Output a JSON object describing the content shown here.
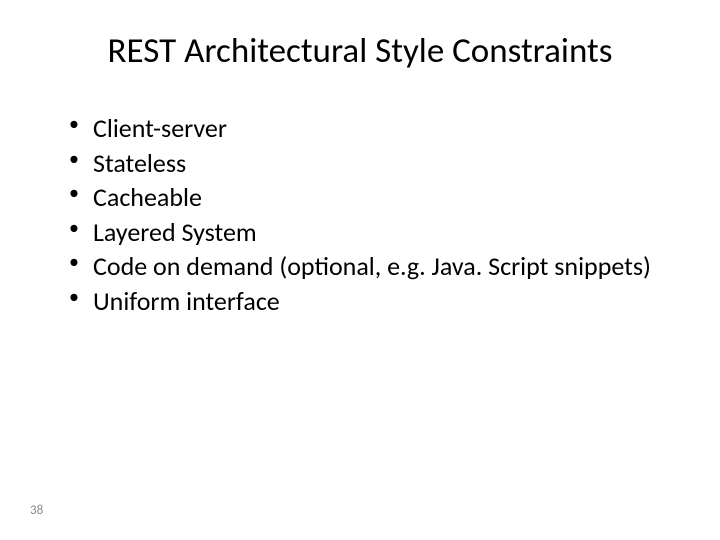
{
  "title": "REST Architectural Style Constraints",
  "bullets": [
    "Client-server",
    "Stateless",
    "Cacheable",
    "Layered System",
    "Code on demand (optional, e.g. Java. Script snippets)",
    "Uniform interface"
  ],
  "page_number": "38"
}
